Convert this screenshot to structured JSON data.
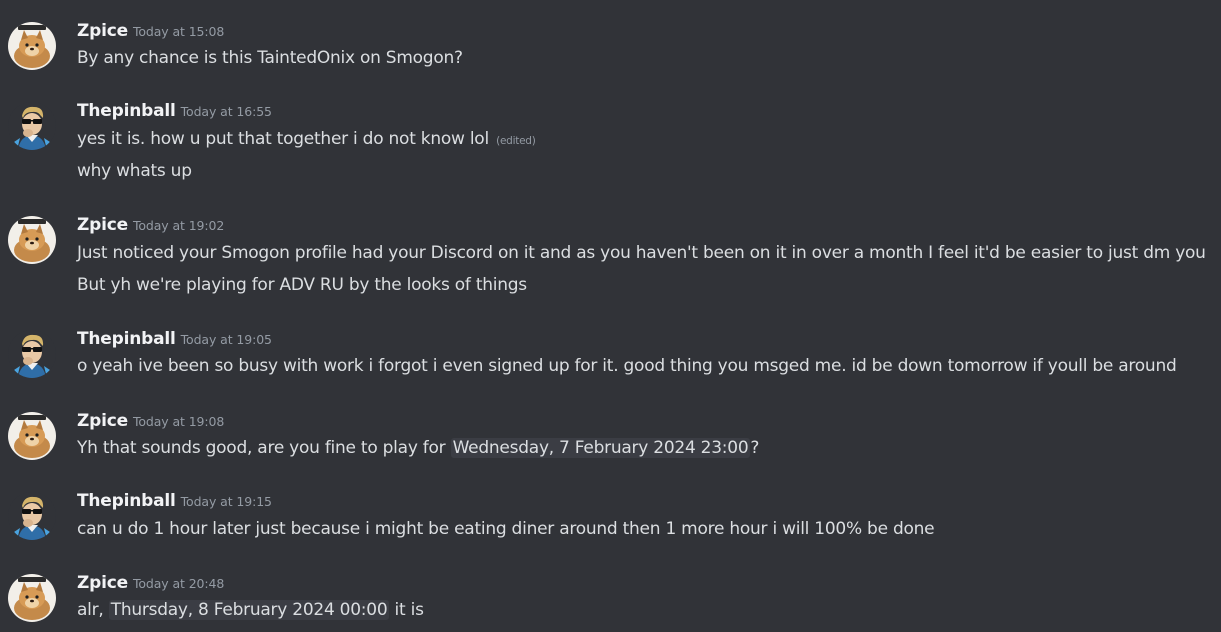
{
  "messages": [
    {
      "author": "Zpice",
      "time": "Today at 15:08",
      "avatar": "shiba-avatar",
      "lines": [
        "By any chance is this TaintedOnix on Smogon?"
      ]
    },
    {
      "author": "Thepinball",
      "time": "Today at 16:55",
      "avatar": "glasses-avatar",
      "lines": [
        "yes it is. how u put that together i do not know lol",
        "why whats up"
      ],
      "edited_label": "(edited)"
    },
    {
      "author": "Zpice",
      "time": "Today at 19:02",
      "avatar": "shiba-avatar",
      "lines": [
        "Just noticed your Smogon profile had your Discord on it and as you haven't been on it in over a month I feel it'd be easier to just dm you",
        "But yh we're playing for ADV RU by the looks of things"
      ]
    },
    {
      "author": "Thepinball",
      "time": "Today at 19:05",
      "avatar": "glasses-avatar",
      "lines": [
        "o yeah ive been so busy with work i forgot i even signed up for it. good thing you msged me. id be down tomorrow if youll be around"
      ]
    },
    {
      "author": "Zpice",
      "time": "Today at 19:08",
      "avatar": "shiba-avatar",
      "line_prefix": "Yh that sounds good, are you fine to play for ",
      "line_timestamp": "Wednesday, 7 February 2024 23:00",
      "line_suffix": "?"
    },
    {
      "author": "Thepinball",
      "time": "Today at 19:15",
      "avatar": "glasses-avatar",
      "lines": [
        "can u do 1 hour later just because i might be eating diner around then 1 more hour i will 100% be done"
      ]
    },
    {
      "author": "Zpice",
      "time": "Today at 20:48",
      "avatar": "shiba-avatar",
      "line_prefix": "alr, ",
      "line_timestamp": "Thursday, 8 February 2024 00:00",
      "line_suffix": " it is"
    }
  ]
}
